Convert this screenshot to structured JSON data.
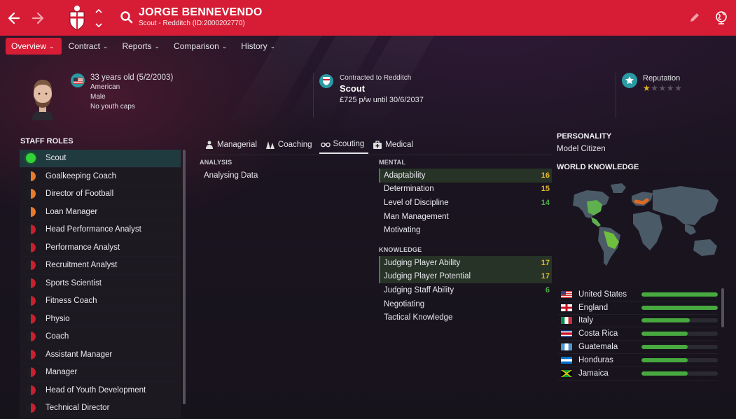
{
  "header": {
    "name": "JORGE BENNEVENDO",
    "subtitle": "Scout - Redditch (ID:2000202770)",
    "icons": {
      "back": "arrow-left-icon",
      "forward": "arrow-right-icon",
      "search": "search-icon",
      "edit": "pencil-icon",
      "globe": "globe-icon"
    }
  },
  "tabs": [
    {
      "label": "Overview",
      "active": true
    },
    {
      "label": "Contract"
    },
    {
      "label": "Reports"
    },
    {
      "label": "Comparison"
    },
    {
      "label": "History"
    }
  ],
  "profile": {
    "age": "33 years old (5/2/2003)",
    "nationality": "American",
    "gender": "Male",
    "caps": "No youth caps",
    "contract_label": "Contracted to Redditch",
    "contract_role": "Scout",
    "wage": "£725 p/w until 30/6/2037",
    "reputation_label": "Reputation",
    "reputation_stars": 1,
    "reputation_max": 5
  },
  "staff_roles": {
    "heading": "STAFF ROLES",
    "items": [
      {
        "label": "Scout",
        "suit": "full",
        "active": true
      },
      {
        "label": "Goalkeeping Coach",
        "suit": "half"
      },
      {
        "label": "Director of Football",
        "suit": "half"
      },
      {
        "label": "Loan Manager",
        "suit": "half"
      },
      {
        "label": "Head Performance Analyst",
        "suit": "low"
      },
      {
        "label": "Performance Analyst",
        "suit": "low"
      },
      {
        "label": "Recruitment Analyst",
        "suit": "low"
      },
      {
        "label": "Sports Scientist",
        "suit": "low"
      },
      {
        "label": "Fitness Coach",
        "suit": "low"
      },
      {
        "label": "Physio",
        "suit": "low"
      },
      {
        "label": "Coach",
        "suit": "low"
      },
      {
        "label": "Assistant Manager",
        "suit": "low"
      },
      {
        "label": "Manager",
        "suit": "low"
      },
      {
        "label": "Head of Youth Development",
        "suit": "low"
      },
      {
        "label": "Technical Director",
        "suit": "low"
      }
    ]
  },
  "attr_tabs": [
    {
      "label": "Managerial",
      "icon": "whistle-icon"
    },
    {
      "label": "Coaching",
      "icon": "cones-icon"
    },
    {
      "label": "Scouting",
      "icon": "binoculars-icon",
      "active": true
    },
    {
      "label": "Medical",
      "icon": "medical-kit-icon"
    }
  ],
  "analysis": {
    "heading": "ANALYSIS",
    "value": "Analysing Data"
  },
  "mental": {
    "heading": "MENTAL",
    "items": [
      {
        "label": "Adaptability",
        "value": "16",
        "hl": true,
        "tone": "gold"
      },
      {
        "label": "Determination",
        "value": "15",
        "tone": "gold"
      },
      {
        "label": "Level of Discipline",
        "value": "14",
        "tone": "green"
      },
      {
        "label": "Man Management",
        "value": ""
      },
      {
        "label": "Motivating",
        "value": ""
      }
    ]
  },
  "knowledge": {
    "heading": "KNOWLEDGE",
    "items": [
      {
        "label": "Judging Player Ability",
        "value": "17",
        "hl": true,
        "tone": "gold"
      },
      {
        "label": "Judging Player Potential",
        "value": "17",
        "hl": true,
        "tone": "gold"
      },
      {
        "label": "Judging Staff Ability",
        "value": "6",
        "tone": "green"
      },
      {
        "label": "Negotiating",
        "value": ""
      },
      {
        "label": "Tactical Knowledge",
        "value": ""
      }
    ]
  },
  "personality": {
    "heading": "PERSONALITY",
    "value": "Model Citizen"
  },
  "world_knowledge": {
    "heading": "WORLD KNOWLEDGE",
    "map_icon": "world-map-icon",
    "items": [
      {
        "country": "United States",
        "flag": "us",
        "level": 1.0
      },
      {
        "country": "England",
        "flag": "en",
        "level": 1.0
      },
      {
        "country": "Italy",
        "flag": "it",
        "level": 0.63
      },
      {
        "country": "Costa Rica",
        "flag": "cr",
        "level": 0.61
      },
      {
        "country": "Guatemala",
        "flag": "gt",
        "level": 0.61
      },
      {
        "country": "Honduras",
        "flag": "hn",
        "level": 0.61
      },
      {
        "country": "Jamaica",
        "flag": "jm",
        "level": 0.61
      }
    ]
  },
  "colors": {
    "brand_red": "#d61d35",
    "accent_teal": "#2a9aa3",
    "good_green": "#47a93f",
    "gold": "#e7b92a"
  }
}
